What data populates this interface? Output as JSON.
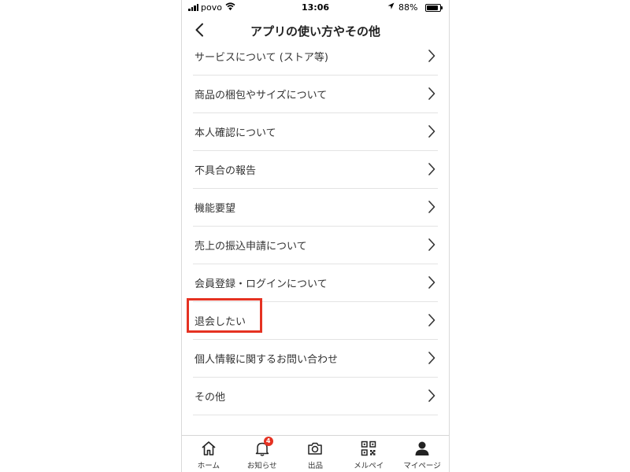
{
  "status_bar": {
    "carrier": "povo",
    "time": "13:06",
    "battery_percent": "88%",
    "battery_level": 0.88
  },
  "header": {
    "title": "アプリの使い方やその他",
    "back_icon": "chevron-left-icon"
  },
  "menu_items": [
    {
      "label": "サービスについて (ストア等)"
    },
    {
      "label": "商品の梱包やサイズについて"
    },
    {
      "label": "本人確認について"
    },
    {
      "label": "不具合の報告"
    },
    {
      "label": "機能要望"
    },
    {
      "label": "売上の振込申請について"
    },
    {
      "label": "会員登録・ログインについて"
    },
    {
      "label": "退会したい",
      "highlighted": true
    },
    {
      "label": "個人情報に関するお問い合わせ"
    },
    {
      "label": "その他"
    }
  ],
  "highlight_color": "#e53222",
  "tab_bar": {
    "tabs": [
      {
        "label": "ホーム",
        "icon": "home-icon"
      },
      {
        "label": "お知らせ",
        "icon": "bell-icon",
        "badge": "4"
      },
      {
        "label": "出品",
        "icon": "camera-icon"
      },
      {
        "label": "メルペイ",
        "icon": "qr-code-icon"
      },
      {
        "label": "マイページ",
        "icon": "person-icon"
      }
    ]
  }
}
